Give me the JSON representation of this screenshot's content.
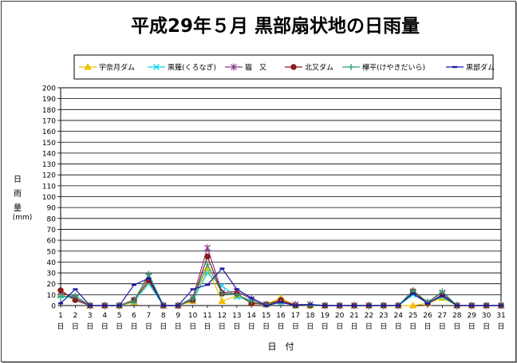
{
  "chart_data": {
    "type": "line",
    "title": "平成29年５月 黒部扇状地の日雨量",
    "ylabel_chars": [
      "日",
      "雨",
      "量"
    ],
    "yunit": "(mm)",
    "xlabel": "日　付",
    "x_day_suffix": "日",
    "ylim": [
      0,
      200
    ],
    "y_ticks": [
      0,
      10,
      20,
      30,
      40,
      50,
      60,
      70,
      80,
      90,
      100,
      110,
      120,
      130,
      140,
      150,
      160,
      170,
      180,
      190,
      200
    ],
    "grid": true,
    "legend_position": "top",
    "categories": [
      "1",
      "2",
      "3",
      "4",
      "5",
      "6",
      "7",
      "8",
      "9",
      "10",
      "11",
      "12",
      "13",
      "14",
      "15",
      "16",
      "17",
      "18",
      "19",
      "20",
      "21",
      "22",
      "23",
      "24",
      "25",
      "26",
      "27",
      "28",
      "29",
      "30",
      "31"
    ],
    "series": [
      {
        "name": "宇奈月ダム",
        "color": "#f0c000",
        "marker": "triangle",
        "values": [
          10,
          6,
          0,
          0,
          0,
          3,
          22,
          0,
          0,
          4,
          34,
          4,
          9,
          3,
          1,
          7,
          0,
          0,
          0,
          0,
          0,
          0,
          0,
          0,
          0,
          2,
          7,
          0,
          0,
          0,
          0
        ]
      },
      {
        "name": "黒薙(くろなぎ)",
        "color": "#00d8e8",
        "marker": "x",
        "values": [
          9,
          6,
          0,
          0,
          0,
          4,
          20,
          0,
          0,
          5,
          30,
          18,
          8,
          4,
          1,
          3,
          0,
          1,
          0,
          0,
          0,
          0,
          0,
          0,
          10,
          3,
          8,
          0,
          0,
          0,
          0
        ]
      },
      {
        "name": "猫　又",
        "color": "#8a3a8a",
        "marker": "star",
        "values": [
          12,
          7,
          0,
          0,
          0,
          5,
          27,
          0,
          0,
          7,
          53,
          12,
          13,
          6,
          1,
          4,
          1,
          1,
          0,
          0,
          0,
          0,
          0,
          0,
          13,
          3,
          12,
          0,
          0,
          0,
          0
        ]
      },
      {
        "name": "北又ダム",
        "color": "#8b1a1a",
        "marker": "circle",
        "values": [
          14,
          5,
          0,
          0,
          0,
          5,
          23,
          0,
          0,
          5,
          45,
          11,
          11,
          2,
          1,
          5,
          0,
          0,
          0,
          0,
          0,
          0,
          0,
          0,
          13,
          2,
          10,
          0,
          0,
          0,
          0
        ]
      },
      {
        "name": "欅平(けやきだいら)",
        "color": "#30a070",
        "marker": "plus",
        "values": [
          8,
          9,
          0,
          0,
          0,
          4,
          29,
          0,
          0,
          6,
          38,
          11,
          10,
          4,
          1,
          3,
          0,
          0,
          0,
          0,
          0,
          0,
          0,
          0,
          14,
          3,
          13,
          0,
          0,
          0,
          0
        ]
      },
      {
        "name": "黒部ダム",
        "color": "#1a1aa8",
        "marker": "dash",
        "values": [
          2,
          15,
          0,
          0,
          0,
          19,
          25,
          0,
          0,
          15,
          19,
          34,
          15,
          7,
          0,
          3,
          0,
          1,
          0,
          0,
          0,
          0,
          0,
          0,
          11,
          2,
          9,
          0,
          0,
          0,
          0
        ]
      }
    ]
  }
}
